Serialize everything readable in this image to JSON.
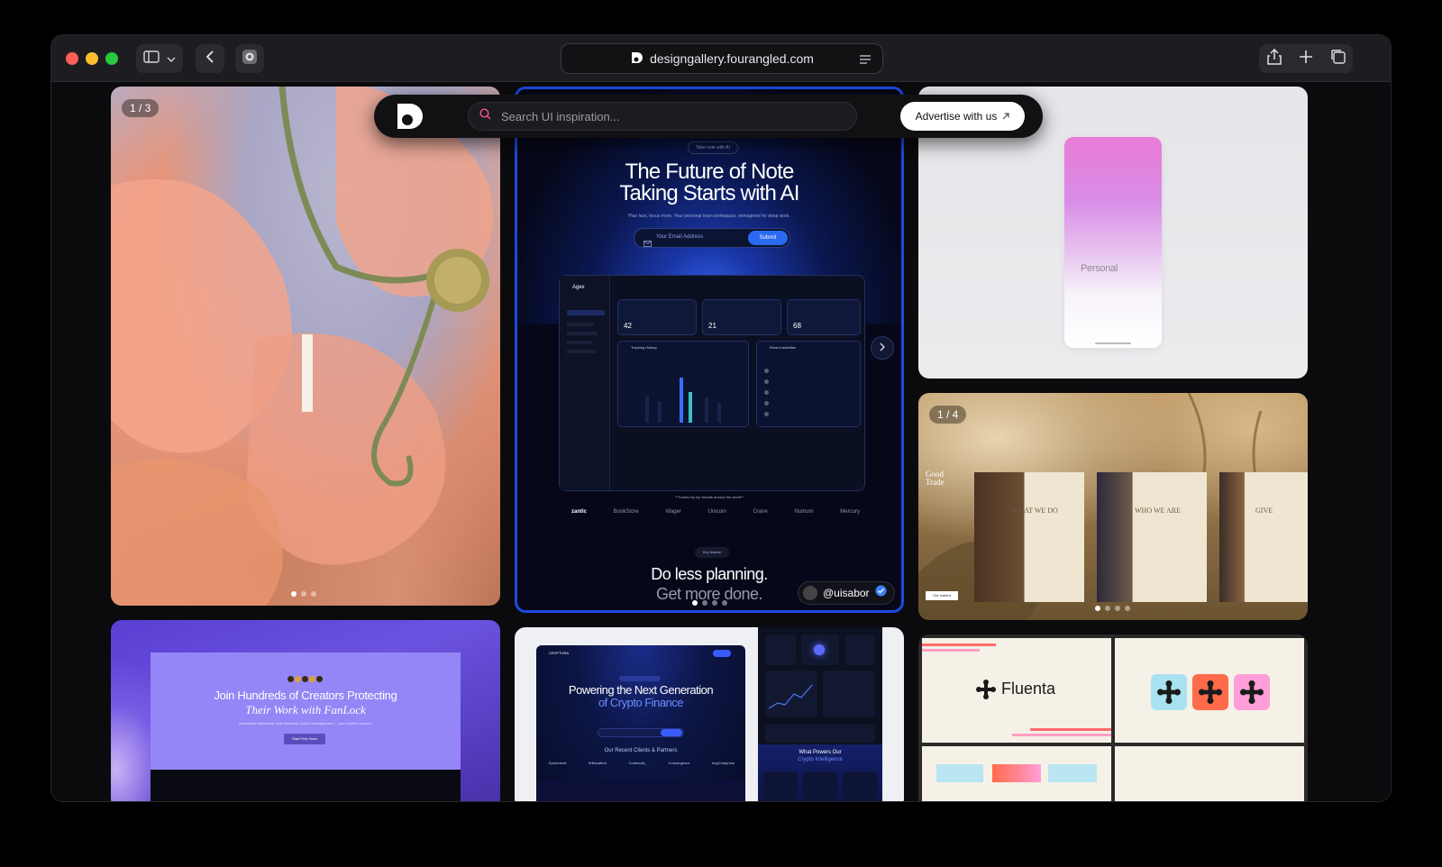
{
  "browser": {
    "url": "designgallery.fourangled.com",
    "traffic_colors": [
      "#ff5f57",
      "#febc2e",
      "#28c840"
    ]
  },
  "topbar": {
    "search_placeholder": "Search UI inspiration...",
    "advertise_label": "Advertise with us",
    "advertise_icon": "arrow-up-right-icon"
  },
  "cards": {
    "flower": {
      "counter": "1 / 3"
    },
    "note_ai": {
      "pill": "Take note with AI",
      "headline_1": "The Future of Note",
      "headline_2": "Taking Starts with AI",
      "subtext": "Plan less, focus more. Your personal team workspace, reimagined for deep work.",
      "email_placeholder": "Your Email Address",
      "submit_label": "Submit",
      "dash_brand": "Agex",
      "stats": [
        "42",
        "21",
        "68"
      ],
      "tracking_label": "Tracking History",
      "activities_label": "Recent activities",
      "trusted": "**Trusted by top brands around the world**",
      "brands": [
        "zantic",
        "BookStore",
        "Wager",
        "Unicoin",
        "Crane",
        "Nutrium",
        "Mercury"
      ],
      "key_feature": "Key feature",
      "tagline_1": "Do less planning.",
      "tagline_2": "Get more done.",
      "author": "@uisabor"
    },
    "personal": {
      "label": "Personal"
    },
    "good_trade": {
      "counter": "1 / 4",
      "brand": "Good Trade",
      "panels": [
        "WHAT WE DO",
        "WHO WE ARE",
        "GIVE"
      ],
      "button": "Get started"
    },
    "fanlock": {
      "title": "Join Hundreds of Creators Protecting",
      "subtitle": "Their Work with FanLock",
      "desc": "Automated takedowns, leak detection, DMCA management — your content, secure.",
      "button": "Start Free Scan"
    },
    "crypto": {
      "brand": "CRYPTORA",
      "headline_1": "Powering the Next Generation",
      "headline_2": "of Crypto Finance",
      "clients_label": "Our Recent Clients & Partners",
      "clients": [
        "Ephemeral",
        "Wildcrafted",
        "Codecraft_",
        "Convergence",
        "ImgCompress"
      ],
      "side_title_1": "What Powers Our",
      "side_title_2": "Crypto Intelligence"
    },
    "fluenta": {
      "brand": "Fluenta"
    }
  }
}
